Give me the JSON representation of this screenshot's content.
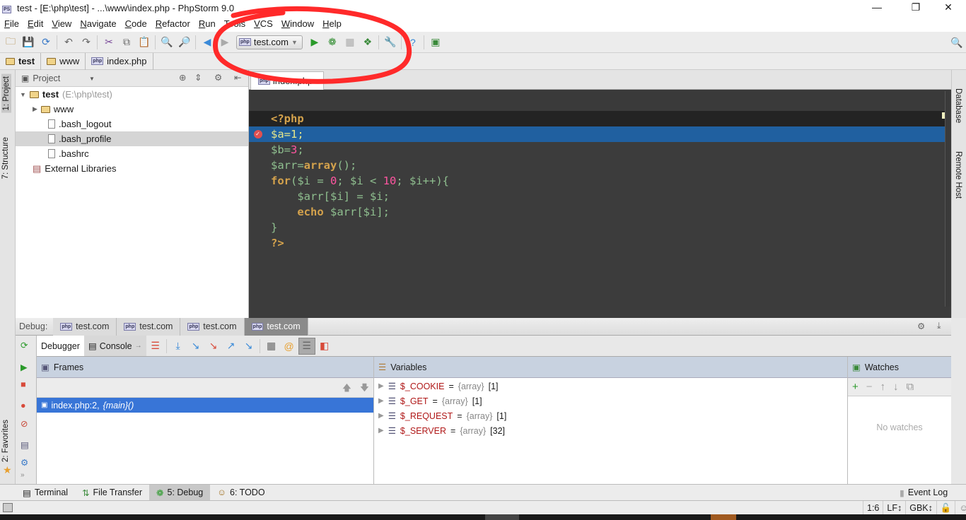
{
  "window": {
    "title": "test - [E:\\php\\test] - ...\\www\\index.php - PhpStorm 9.0"
  },
  "menu": [
    "File",
    "Edit",
    "View",
    "Navigate",
    "Code",
    "Refactor",
    "Run",
    "Tools",
    "VCS",
    "Window",
    "Help"
  ],
  "toolbar": {
    "run_config": "test.com"
  },
  "breadcrumb": [
    "test",
    "www",
    "index.php"
  ],
  "left_stripe": {
    "project": "1: Project",
    "structure": "7: Structure",
    "favorites": "2: Favorites"
  },
  "right_stripe": {
    "database": "Database",
    "remote": "Remote Host"
  },
  "project": {
    "view": "Project",
    "root": "test",
    "root_path": "(E:\\php\\test)",
    "items": [
      "www",
      ".bash_logout",
      ".bash_profile",
      ".bashrc",
      "External Libraries"
    ]
  },
  "editor": {
    "tab": "index.php",
    "lines": [
      [
        [
          "<?php",
          "kw"
        ]
      ],
      [
        [
          "$a=1;",
          ""
        ]
      ],
      [
        [
          "$b=",
          ""
        ],
        [
          "3",
          "num"
        ],
        [
          ";",
          ""
        ]
      ],
      [
        [
          "$arr=",
          ""
        ],
        [
          "array",
          "kw"
        ],
        [
          "();",
          ""
        ]
      ],
      [
        [
          "for",
          "kw"
        ],
        [
          "($i = ",
          ""
        ],
        [
          "0",
          "num"
        ],
        [
          "; $i < ",
          ""
        ],
        [
          "10",
          "num"
        ],
        [
          "; $i++){",
          ""
        ]
      ],
      [
        [
          "    $arr[$i] = $i;",
          ""
        ]
      ],
      [
        [
          "    ",
          ""
        ],
        [
          "echo",
          "kw"
        ],
        [
          " $arr[$i];",
          ""
        ]
      ],
      [
        [
          "}",
          ""
        ]
      ],
      [
        [
          "?>",
          "kw"
        ]
      ]
    ]
  },
  "debug": {
    "label": "Debug:",
    "tabs": [
      "test.com",
      "test.com",
      "test.com",
      "test.com"
    ],
    "debugger": "Debugger",
    "console": "Console",
    "frames": {
      "title": "Frames",
      "items": [
        {
          "file": "index.php:2,",
          "fn": "{main}()"
        }
      ]
    },
    "variables": {
      "title": "Variables",
      "items": [
        {
          "name": "$_COOKIE",
          "type": "{array}",
          "count": "[1]"
        },
        {
          "name": "$_GET",
          "type": "{array}",
          "count": "[1]"
        },
        {
          "name": "$_REQUEST",
          "type": "{array}",
          "count": "[1]"
        },
        {
          "name": "$_SERVER",
          "type": "{array}",
          "count": "[32]"
        }
      ]
    },
    "watches": {
      "title": "Watches",
      "empty": "No watches"
    }
  },
  "bottom_tabs": [
    "Terminal",
    "File Transfer",
    "5: Debug",
    "6: TODO"
  ],
  "event_log": "Event Log",
  "status": {
    "position": "1:6",
    "line_sep": "LF↕",
    "encoding": "GBK↕"
  },
  "colors": {
    "selection": "#2060a0",
    "frame_selection": "#3875d7",
    "annotation": "#ff2a2a"
  }
}
